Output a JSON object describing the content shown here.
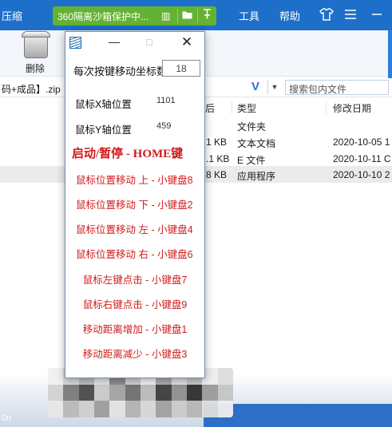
{
  "bg": {
    "menu_partial": "压缩",
    "menu_tools": "工具",
    "menu_help": "帮助",
    "delete_label": "删除",
    "path_text": "码+成品】.zip",
    "search_placeholder": "搜索包内文件",
    "columns": {
      "size": "后",
      "type": "类型",
      "modified": "修改日期"
    },
    "rows": [
      {
        "size": "",
        "type": "文件夹",
        "modified": ""
      },
      {
        "size": "1 KB",
        "type": "文本文档",
        "modified": "2020-10-05 1"
      },
      {
        "size": ".1 KB",
        "type": "E 文件",
        "modified": "2020-10-11 C"
      },
      {
        "size": "8 KB",
        "type": "应用程序",
        "modified": "2020-10-10 2"
      }
    ],
    "status_partial": "0n"
  },
  "sandbox": {
    "label": "360隔离沙箱保护中...",
    "icons": [
      "cabinet-icon",
      "folder-icon",
      "pin-icon"
    ]
  },
  "dialog": {
    "buttons": {
      "minimize": "—",
      "maximize": "□",
      "close": "✕"
    },
    "step_label": "每次按键移动坐标数",
    "step_value": "18",
    "x_label": "鼠标X轴位置",
    "x_value": "1101",
    "y_label": "鼠标Y轴位置",
    "y_value": "459",
    "start_stop": "启动/暂停 - HOME键",
    "hotkeys": {
      "up": "鼠标位置移动 上 - 小键盘8",
      "down": "鼠标位置移动 下 - 小键盘2",
      "left": "鼠标位置移动 左 - 小键盘4",
      "right": "鼠标位置移动 右 - 小键盘6",
      "left_click": "鼠标左键点击 - 小键盘7",
      "right_click": "鼠标右键点击 - 小键盘9",
      "step_increase": "移动距离增加 - 小键盘1",
      "step_decrease": "移动距离减少 - 小键盘3"
    }
  },
  "colors": {
    "accent_red": "#d11a1a",
    "titlebar_blue": "#1e6fc9",
    "sandbox_green": "#64b234"
  }
}
